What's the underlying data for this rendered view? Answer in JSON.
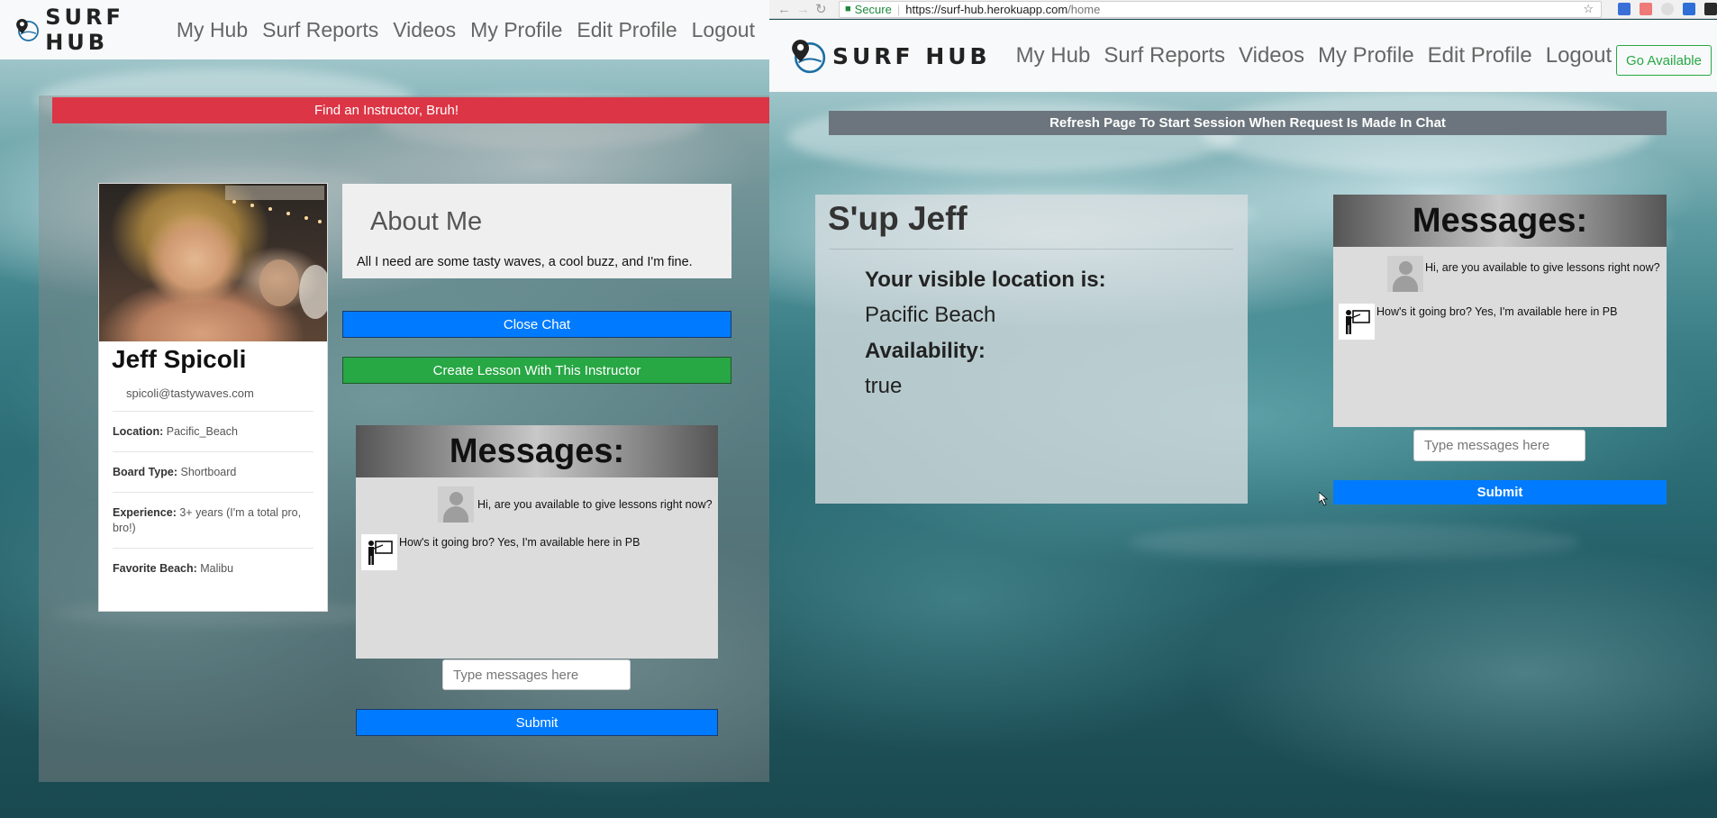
{
  "left": {
    "brand": "SURF HUB",
    "nav": [
      "My Hub",
      "Surf Reports",
      "Videos",
      "My Profile",
      "Edit Profile",
      "Logout"
    ],
    "find_banner": "Find an Instructor, Bruh!",
    "profile": {
      "name": "Jeff Spicoli",
      "email": "spicoli@tastywaves.com",
      "rows": [
        {
          "label": "Location:",
          "value": "Pacific_Beach"
        },
        {
          "label": "Board Type:",
          "value": "Shortboard"
        },
        {
          "label": "Experience:",
          "value": "3+ years (I'm a total pro, bro!)"
        },
        {
          "label": "Favorite Beach:",
          "value": "Malibu"
        }
      ]
    },
    "about": {
      "title": "About Me",
      "text": "All I need are some tasty waves, a cool buzz, and I'm fine."
    },
    "close_chat": "Close Chat",
    "create_lesson": "Create Lesson With This Instructor",
    "chat": {
      "title": "Messages:",
      "messages": [
        {
          "from": "user",
          "text": "Hi, are you available to give lessons right now?"
        },
        {
          "from": "instructor",
          "text": "How's it going bro? Yes, I'm available here in PB"
        }
      ],
      "placeholder": "Type messages here",
      "submit": "Submit"
    }
  },
  "right": {
    "browser": {
      "secure_label": "Secure",
      "url_host": "https://surf-hub.herokuapp.com",
      "url_path": "/home"
    },
    "brand": "SURF HUB",
    "nav": [
      "My Hub",
      "Surf Reports",
      "Videos",
      "My Profile",
      "Edit Profile",
      "Logout"
    ],
    "go_available": "Go Available",
    "refresh_banner": "Refresh Page To Start Session When Request Is Made In Chat",
    "greeting": {
      "title": "S'up Jeff",
      "location_label": "Your visible location is:",
      "location_value": "Pacific Beach",
      "availability_label": "Availability:",
      "availability_value": "true"
    },
    "chat": {
      "title": "Messages:",
      "messages": [
        {
          "from": "user",
          "text": "Hi, are you available to give lessons right now?"
        },
        {
          "from": "instructor",
          "text": "How's it going bro? Yes, I'm available here in PB"
        }
      ],
      "placeholder": "Type messages here",
      "submit": "Submit"
    }
  },
  "colors": {
    "danger": "#dc3545",
    "primary": "#007bff",
    "success": "#28a745",
    "secondary": "#6c757d"
  },
  "icons": [
    "map-pin-logo-icon",
    "user-avatar-icon",
    "instructor-icon",
    "lock-icon",
    "back-arrow-icon",
    "forward-arrow-icon",
    "reload-icon",
    "star-icon",
    "cursor-icon"
  ]
}
